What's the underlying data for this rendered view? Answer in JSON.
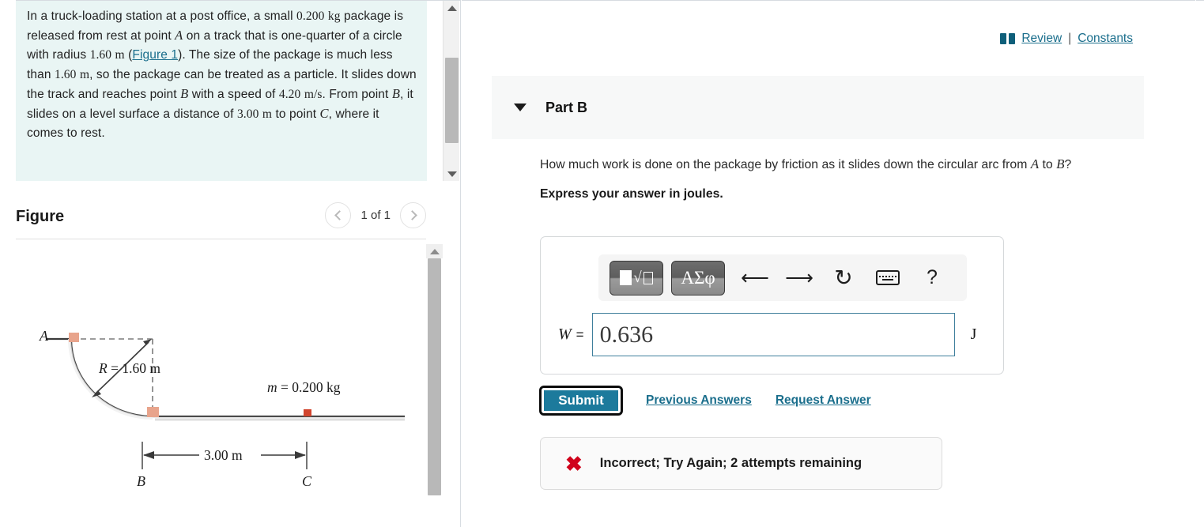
{
  "left": {
    "problem": {
      "line1": "In a truck-loading station at a post office, a small",
      "mass": "0.200",
      "mass_unit": "kg",
      "seg2": " package is released from rest at point ",
      "point_a": "A",
      "seg3": " on a track that is one-quarter of a circle with radius ",
      "radius": "1.60",
      "radius_unit": "m",
      "seg4": " (",
      "figure_link": "Figure 1",
      "seg5": "). The size of the package is much less than ",
      "radius2": "1.60",
      "radius2_unit": "m",
      "seg6": ", so the package can be treated as a particle. It slides down the track and reaches point ",
      "point_b": "B",
      "seg7": " with a speed of ",
      "speed": "4.20",
      "speed_unit": "m/s",
      "seg8": ". From point ",
      "point_b2": "B",
      "seg9": ", it slides on a level surface a distance of ",
      "distance": "3.00",
      "distance_unit": "m",
      "seg10": " to point ",
      "point_c": "C",
      "seg11": ", where it comes to rest."
    },
    "figure": {
      "title": "Figure",
      "counter": "1 of 1",
      "prev_icon": "chevron-left-icon",
      "next_icon": "chevron-right-icon",
      "labels": {
        "a": "A",
        "b": "B",
        "c": "C",
        "radius": "R = 1.60 m",
        "mass": "m = 0.200 kg",
        "distance": "3.00 m"
      }
    }
  },
  "right": {
    "header": {
      "book_icon": "book-icon",
      "review_label": "Review",
      "separator": "|",
      "constants_label": "Constants"
    },
    "part": {
      "caret_icon": "caret-down-icon",
      "title": "Part B"
    },
    "question": {
      "text_1": "How much work is done on the package by friction as it slides down the circular arc from ",
      "var_a": "A",
      "text_2": " to ",
      "var_b": "B",
      "text_3": "?",
      "express": "Express your answer in joules."
    },
    "toolbar": {
      "template_icon": "math-template-icon",
      "greek_label": "ΑΣφ",
      "undo_icon": "undo-arrow-icon",
      "redo_icon": "redo-arrow-icon",
      "reset_icon": "reset-circular-arrow-icon",
      "keyboard_icon": "keyboard-icon",
      "help_label": "?"
    },
    "answer": {
      "variable": "W",
      "equals": "=",
      "value": "0.636",
      "placeholder": "",
      "unit": "J"
    },
    "actions": {
      "submit_label": "Submit",
      "previous_answers_label": "Previous Answers",
      "request_answer_label": "Request Answer"
    },
    "feedback": {
      "icon": "x-mark-icon",
      "message": "Incorrect; Try Again; 2 attempts remaining"
    }
  },
  "colors": {
    "link": "#1a6e8c",
    "problem_bg": "#e9f5f4",
    "submit_bg": "#1c7a9c",
    "error": "#d0021b",
    "input_border": "#3f7f9c",
    "block_fill": "#e8a48c"
  }
}
